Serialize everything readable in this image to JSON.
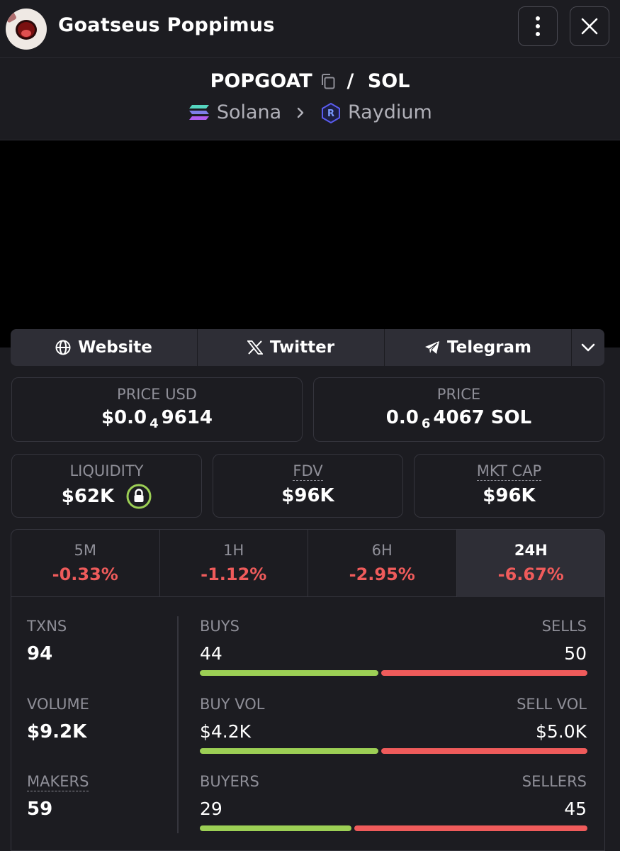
{
  "header": {
    "token_name": "Goatseus Poppimus",
    "menu_icon": "more-vertical-icon",
    "close_icon": "close-icon"
  },
  "pair": {
    "base": "POPGOAT",
    "separator": "/",
    "quote": "SOL",
    "chain": "Solana",
    "dex": "Raydium"
  },
  "links": {
    "website": "Website",
    "twitter": "Twitter",
    "telegram": "Telegram"
  },
  "prices": {
    "price_usd_label": "PRICE USD",
    "price_usd_prefix": "$0.0",
    "price_usd_zeros": "4",
    "price_usd_digits": "9614",
    "price_label": "PRICE",
    "price_prefix": "0.0",
    "price_zeros": "6",
    "price_digits": "4067 SOL"
  },
  "metrics": {
    "liquidity_label": "LIQUIDITY",
    "liquidity_value": "$62K",
    "fdv_label": "FDV",
    "fdv_value": "$96K",
    "mktcap_label": "MKT CAP",
    "mktcap_value": "$96K"
  },
  "periods": [
    {
      "label": "5M",
      "change": "-0.33%"
    },
    {
      "label": "1H",
      "change": "-1.12%"
    },
    {
      "label": "6H",
      "change": "-2.95%"
    },
    {
      "label": "24H",
      "change": "-6.67%"
    }
  ],
  "activity": {
    "txns_label": "TXNS",
    "txns_value": "94",
    "volume_label": "VOLUME",
    "volume_value": "$9.2K",
    "makers_label": "MAKERS",
    "makers_value": "59",
    "buys_label": "BUYS",
    "buys_value": "44",
    "sells_label": "SELLS",
    "sells_value": "50",
    "buy_vol_label": "BUY VOL",
    "buy_vol_value": "$4.2K",
    "sell_vol_label": "SELL VOL",
    "sell_vol_value": "$5.0K",
    "buyers_label": "BUYERS",
    "buyers_value": "29",
    "sellers_label": "SELLERS",
    "sellers_value": "45"
  },
  "colors": {
    "positive": "#9ccf55",
    "negative": "#ef5b5b",
    "background": "#1c1c21"
  }
}
